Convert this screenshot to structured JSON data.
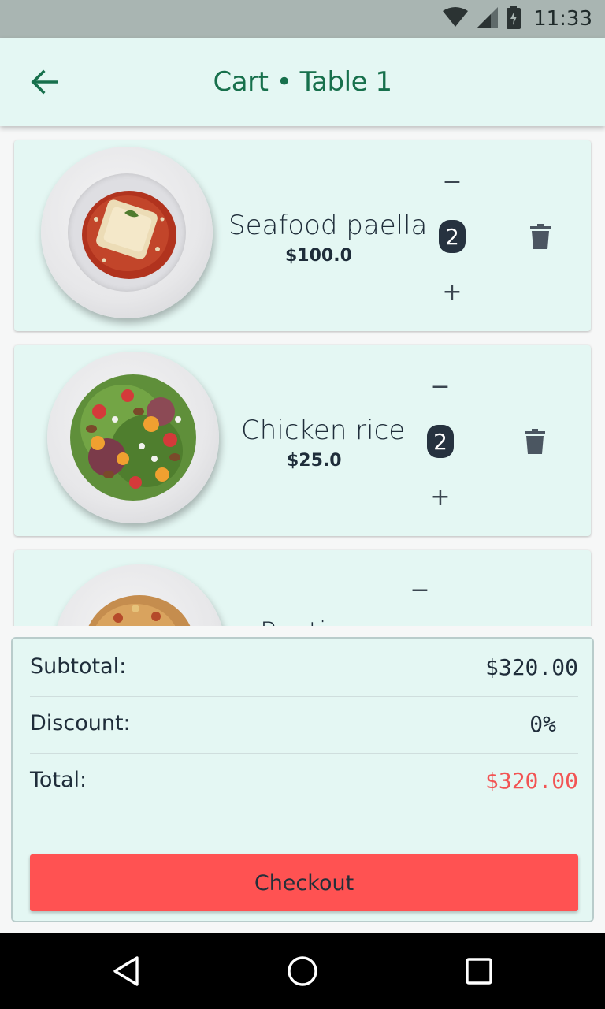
{
  "status_bar": {
    "time": "11:33",
    "icons": [
      "wifi-icon",
      "signal-icon",
      "battery-charging-icon"
    ]
  },
  "app_bar": {
    "title": "Cart • Table 1",
    "back_icon": "arrow-back-icon"
  },
  "cart": {
    "items": [
      {
        "name": "Seafood paella",
        "price": "$100.0",
        "quantity": "2",
        "minus": "−",
        "plus": "+",
        "image": "lasagna-plate"
      },
      {
        "name": "Chicken rice",
        "price": "$25.0",
        "quantity": "2",
        "minus": "−",
        "plus": "+",
        "image": "salad-plate"
      },
      {
        "name": "Poutine",
        "price": "",
        "quantity": "",
        "minus": "−",
        "plus": "+",
        "image": "pasta-plate"
      }
    ]
  },
  "summary": {
    "subtotal_label": "Subtotal:",
    "subtotal_value": "$320.00",
    "discount_label": "Discount:",
    "discount_value": "0%",
    "total_label": "Total:",
    "total_value": "$320.00",
    "checkout_label": "Checkout"
  },
  "colors": {
    "accent_green": "#17704c",
    "card_bg": "#e4f7f3",
    "checkout_red": "#ff5252",
    "total_red": "#f25454",
    "badge_dark": "#26323f"
  },
  "nav_bar": {
    "icons": [
      "back-triangle-icon",
      "home-circle-icon",
      "recents-square-icon"
    ]
  }
}
